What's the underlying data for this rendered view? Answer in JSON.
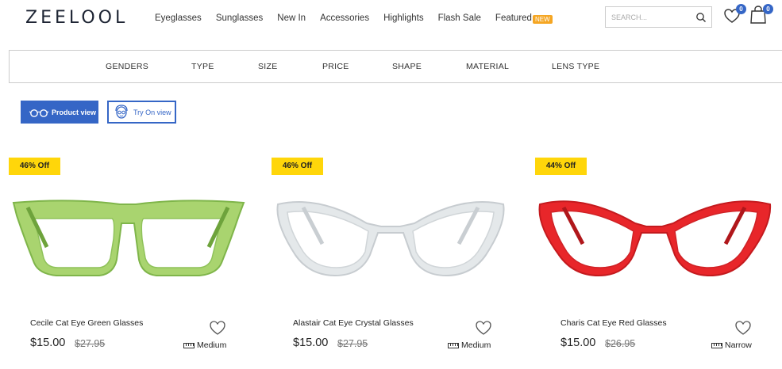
{
  "header": {
    "logo": "ZEELOOL",
    "nav": [
      "Eyeglasses",
      "Sunglasses",
      "New In",
      "Accessories",
      "Highlights",
      "Flash Sale",
      "Featured"
    ],
    "new_badge": "NEW",
    "search_placeholder": "SEARCH...",
    "wishlist_count": "0",
    "cart_count": "0"
  },
  "filters": [
    "GENDERS",
    "TYPE",
    "SIZE",
    "PRICE",
    "SHAPE",
    "MATERIAL",
    "LENS TYPE"
  ],
  "view_toggle": {
    "product_view": "Product view",
    "try_on_view": "Try On view"
  },
  "products": [
    {
      "discount": "46% Off",
      "name": "Cecile Cat Eye Green Glasses",
      "price": "$15.00",
      "old_price": "$27.95",
      "size": "Medium",
      "frame_color": "#9ed16a"
    },
    {
      "discount": "46% Off",
      "name": "Alastair Cat Eye Crystal Glasses",
      "price": "$15.00",
      "old_price": "$27.95",
      "size": "Medium",
      "frame_color": "#dfe3e6"
    },
    {
      "discount": "44% Off",
      "name": "Charis Cat Eye Red Glasses",
      "price": "$15.00",
      "old_price": "$26.95",
      "size": "Narrow",
      "frame_color": "#e8262a"
    }
  ],
  "colors": {
    "accent": "#3566c6",
    "badge": "#ffd60a",
    "new_badge": "#f5a623"
  }
}
